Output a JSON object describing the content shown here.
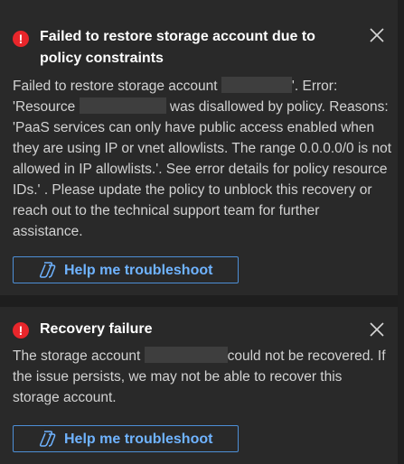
{
  "notifications": [
    {
      "title": "Failed to restore storage account due to policy constraints",
      "body_1": "Failed to restore storage account",
      "body_2": "'. Error: 'Resource",
      "body_3": "was disallowed by policy. Reasons: 'PaaS services can only have public access enabled when they are using IP or vnet allowlists. The range 0.0.0.0/0 is not allowed in IP allowlists.'. See error details for policy resource IDs.' . Please update the policy to unblock this recovery or reach out to the technical support team for further assistance.",
      "button_label": "Help me troubleshoot",
      "icon": "error-icon",
      "icon_glyph": "!",
      "close_icon": "close-icon"
    },
    {
      "title": "Recovery failure",
      "body_1": "The storage account",
      "body_2": "could not be recovered. If the issue persists, we may not be able to recover this storage account.",
      "button_label": "Help me troubleshoot",
      "icon": "error-icon",
      "icon_glyph": "!",
      "close_icon": "close-icon"
    }
  ],
  "colors": {
    "background": "#1b1b1b",
    "toast_background": "#292929",
    "error": "#e8262b",
    "link_blue": "#6fb3ff",
    "button_border": "#4d8fd6"
  }
}
